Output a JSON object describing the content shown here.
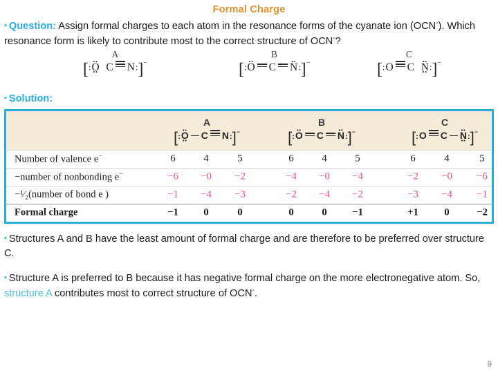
{
  "slide": {
    "title": "Formal Charge",
    "number": "9"
  },
  "question": {
    "bullet": "square-bullet",
    "label": "Question:",
    "text_1": " Assign formal charges to each atom in the resonance forms of the cyanate ion (OCN",
    "sup_1": "-",
    "text_2": "). Which resonance form is likely to contribute most to the correct structure of OCN",
    "sup_2": "-",
    "text_3": "?"
  },
  "solution": {
    "bullet": "square-bullet",
    "label": "Solution:"
  },
  "resonance_forms": [
    {
      "letter": "A",
      "formula": "[:O(..)  C=N:]-",
      "left_atom": "O",
      "center_atom": "C",
      "right_atom": "N",
      "bond_left": "none",
      "bond_right": "triple"
    },
    {
      "letter": "B",
      "formula": "[:O=C=N:]-",
      "left_atom": "O",
      "center_atom": "C",
      "right_atom": "N",
      "bond_left": "double",
      "bond_right": "double"
    },
    {
      "letter": "C",
      "formula": "[:O=C  N:]-",
      "left_atom": "O",
      "center_atom": "C",
      "right_atom": "N",
      "bond_left": "triple",
      "bond_right": "none"
    }
  ],
  "table": {
    "columns": [
      "A",
      "B",
      "C"
    ],
    "atoms_per_column": [
      "O",
      "C",
      "N"
    ],
    "structures": [
      {
        "letter": "A",
        "left_atom": "O",
        "center_atom": "C",
        "right_atom": "N",
        "bond_left": "single",
        "bond_right": "triple"
      },
      {
        "letter": "B",
        "left_atom": "O",
        "center_atom": "C",
        "right_atom": "N",
        "bond_left": "double",
        "bond_right": "double"
      },
      {
        "letter": "C",
        "left_atom": "O",
        "center_atom": "C",
        "right_atom": "N",
        "bond_left": "triple",
        "bond_right": "single"
      }
    ],
    "rows": [
      {
        "label": "Number of valence e",
        "label_sup": "−",
        "style": "plain",
        "values": [
          "6",
          "4",
          "5",
          "6",
          "4",
          "5",
          "6",
          "4",
          "5"
        ]
      },
      {
        "label": "−number of nonbonding e",
        "label_sup": "−",
        "style": "pink",
        "values": [
          "−6",
          "−0",
          "−2",
          "−4",
          "−0",
          "−4",
          "−2",
          "−0",
          "−6"
        ]
      },
      {
        "label": "−¹⁄₂(number of bond e  )",
        "label_sup": "",
        "style": "pink",
        "values": [
          "−1",
          "−4",
          "−3",
          "−2",
          "−4",
          "−2",
          "−3",
          "−4",
          "−1"
        ]
      },
      {
        "label": "Formal charge",
        "label_sup": "",
        "style": "bold",
        "values": [
          "−1",
          "0",
          "0",
          "0",
          "0",
          "−1",
          "+1",
          "0",
          "−2"
        ]
      }
    ]
  },
  "conclusions": {
    "first": {
      "bullet": "square-bullet",
      "text": "Structures A and B have the least amount of formal charge and are therefore to be preferred over structure C."
    },
    "second": {
      "bullet": "square-bullet",
      "text_before": "Structure A is preferred to B because it has negative formal charge on the more electronegative atom. So, ",
      "highlight": "structure A",
      "text_after": " contributes most to correct structure of OCN",
      "sup": "-",
      "text_end": "."
    }
  },
  "colors": {
    "title": "#E0912F",
    "accent_cyan": "#2BAEDC",
    "table_bg": "#F4EBD9",
    "pink": "#E0509B",
    "text": "#1a1a1a"
  }
}
